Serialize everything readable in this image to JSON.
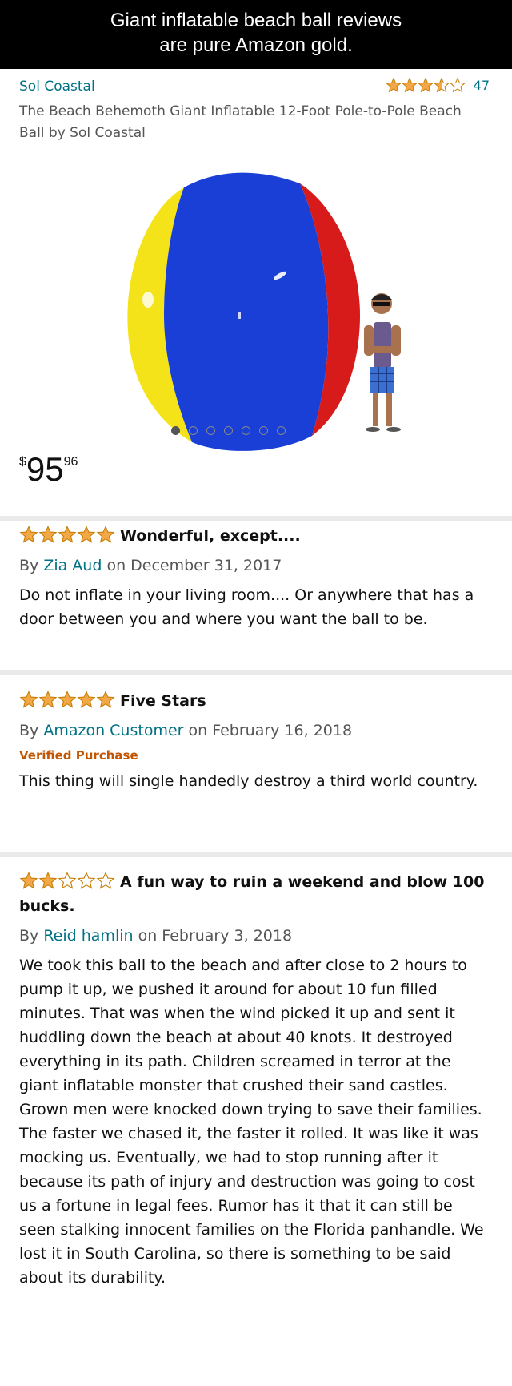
{
  "banner": {
    "line1": "Giant inflatable beach ball reviews",
    "line2": "are pure Amazon gold."
  },
  "product": {
    "brand": "Sol Coastal",
    "rating_stars": 3.5,
    "rating_count": "47",
    "title": "The Beach Behemoth Giant Inflatable 12-Foot Pole-to-Pole Beach Ball by Sol Coastal",
    "image_dots": 7,
    "active_dot": 0,
    "price": {
      "symbol": "$",
      "whole": "95",
      "fraction": "96"
    }
  },
  "reviews": [
    {
      "stars": 5,
      "title": "Wonderful, except....",
      "by": "By",
      "author": "Zia Aud",
      "date": "on December 31, 2017",
      "verified": "",
      "body": "Do not inflate in your living room.... Or anywhere that has a door between you and where you want the ball to be."
    },
    {
      "stars": 5,
      "title": "Five Stars",
      "by": "By",
      "author": "Amazon Customer",
      "date": "on February 16, 2018",
      "verified": "Verified Purchase",
      "body": "This thing will single handedly destroy a third world country."
    },
    {
      "stars": 2,
      "title": "A fun way to ruin a weekend and blow 100 bucks.",
      "by": "By",
      "author": "Reid hamlin",
      "date": "on February 3, 2018",
      "verified": "",
      "body": "We took this ball to the beach and after close to 2 hours to pump it up, we pushed it around for about 10 fun filled minutes. That was when the wind picked it up and sent it huddling down the beach at about 40 knots. It destroyed everything in its path. Children screamed in terror at the giant inflatable monster that crushed their sand castles. Grown men were knocked down trying to save their families. The faster we chased it, the faster it rolled. It was like it was mocking us. Eventually, we had to stop running after it because its path of injury and destruction was going to cost us a fortune in legal fees. Rumor has it that it can still be seen stalking innocent families on the Florida panhandle. We lost it in South Carolina, so there is something to be said about its durability."
    }
  ],
  "colors": {
    "star": "#f3a847",
    "star_stroke": "#c7800a",
    "link": "#007185",
    "verified": "#c45500"
  }
}
